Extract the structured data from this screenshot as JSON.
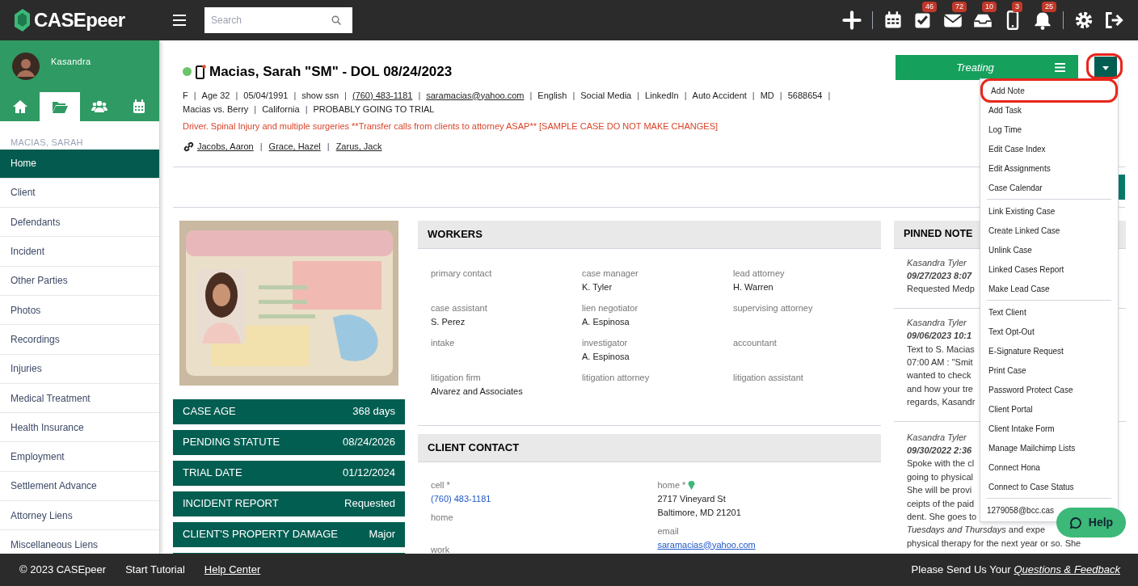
{
  "topbar": {
    "brand": "CASEpeer",
    "search": {
      "placeholder": "Search"
    },
    "icons": [
      {
        "kind": "plus"
      },
      {
        "kind": "divider"
      },
      {
        "kind": "calendar"
      },
      {
        "kind": "tasks",
        "badge": "46"
      },
      {
        "kind": "mail",
        "badge": "72"
      },
      {
        "kind": "inbox",
        "badge": "10"
      },
      {
        "kind": "phone",
        "badge": "3"
      },
      {
        "kind": "bell",
        "badge": "25"
      },
      {
        "kind": "divider"
      },
      {
        "kind": "gear"
      },
      {
        "kind": "logout"
      }
    ]
  },
  "sidebar": {
    "user": "Kasandra",
    "tabs": [
      {
        "kind": "home",
        "selected": false
      },
      {
        "kind": "folder",
        "selected": true
      },
      {
        "kind": "people",
        "selected": false
      },
      {
        "kind": "calendar",
        "selected": false
      }
    ],
    "case_label": "MACIAS, SARAH",
    "items": [
      {
        "label": "Home",
        "selected": true
      },
      {
        "label": "Client",
        "selected": false
      },
      {
        "label": "Defendants",
        "selected": false
      },
      {
        "label": "Incident",
        "selected": false
      },
      {
        "label": "Other Parties",
        "selected": false
      },
      {
        "label": "Photos",
        "selected": false
      },
      {
        "label": "Recordings",
        "selected": false
      },
      {
        "label": "Injuries",
        "selected": false
      },
      {
        "label": "Medical Treatment",
        "selected": false
      },
      {
        "label": "Health Insurance",
        "selected": false
      },
      {
        "label": "Employment",
        "selected": false
      },
      {
        "label": "Settlement Advance",
        "selected": false
      },
      {
        "label": "Attorney Liens",
        "selected": false
      },
      {
        "label": "Miscellaneous Liens",
        "selected": false
      }
    ]
  },
  "case": {
    "online": true,
    "title": "Macias, Sarah \"SM\" - DOL 08/24/2023",
    "info": [
      {
        "text": "F",
        "link": false
      },
      {
        "text": "Age 32",
        "link": false
      },
      {
        "text": "05/04/1991",
        "link": false
      },
      {
        "text": "show ssn",
        "link": false
      },
      {
        "text": "(760) 483-1181",
        "link": true
      },
      {
        "text": "saramacias@yahoo.com",
        "link": true
      },
      {
        "text": "English",
        "link": false
      },
      {
        "text": "Social Media",
        "link": false
      },
      {
        "text": "LinkedIn",
        "link": false
      },
      {
        "text": "Auto Accident",
        "link": false
      },
      {
        "text": "MD",
        "link": false
      },
      {
        "text": "5688654",
        "link": false
      },
      {
        "text": "Macias vs. Berry",
        "link": false
      },
      {
        "text": "California",
        "link": false
      },
      {
        "text": "PROBABLY GOING TO TRIAL",
        "link": false
      }
    ],
    "alert": "Driver. Spinal Injury and multiple surgeries **Transfer calls from clients to attorney ASAP** [SAMPLE CASE DO NOT MAKE CHANGES]",
    "linked": [
      "Jacobs, Aaron",
      "Grace, Hazel",
      "Zarus, Jack"
    ],
    "status": "Treating",
    "separator": "|",
    "toggle_highlighted": true
  },
  "stats": [
    {
      "label": "CASE AGE",
      "value": "368 days"
    },
    {
      "label": "PENDING STATUTE",
      "value": "08/24/2026"
    },
    {
      "label": "TRIAL DATE",
      "value": "01/12/2024"
    },
    {
      "label": "INCIDENT REPORT",
      "value": "Requested"
    },
    {
      "label": "CLIENT'S PROPERTY DAMAGE",
      "value": "Major"
    }
  ],
  "workers": {
    "title": "WORKERS",
    "fields": [
      {
        "label": "primary contact"
      },
      {
        "label": "case manager",
        "value": "K. Tyler"
      },
      {
        "label": "lead attorney",
        "value": "H. Warren"
      },
      {
        "label": "case assistant",
        "value": "S. Perez"
      },
      {
        "label": "lien negotiator",
        "value": "A. Espinosa"
      },
      {
        "label": "supervising attorney"
      },
      {
        "label": "intake"
      },
      {
        "label": "investigator",
        "value": "A. Espinosa"
      },
      {
        "label": "accountant"
      },
      {
        "label": "litigation firm",
        "value": "Alvarez and Associates"
      },
      {
        "label": "litigation attorney"
      },
      {
        "label": "litigation assistant"
      }
    ]
  },
  "client_contact": {
    "title": "CLIENT CONTACT",
    "left": [
      {
        "label": "cell *",
        "lines": [
          "(760) 483-1181"
        ],
        "link": true
      },
      {
        "label": "home"
      },
      {
        "label": "work"
      }
    ],
    "right": [
      {
        "label": "home *",
        "pin": true,
        "lines": [
          "2717 Vineyard St",
          "Baltimore, MD 21201"
        ]
      },
      {
        "label": "email",
        "lines": [
          "saramacias@yahoo.com"
        ],
        "link": true
      }
    ]
  },
  "pinned_notes": {
    "title": "PINNED NOTE",
    "notes": [
      {
        "author": "Kasandra Tyler",
        "date": "09/27/2023 8:07",
        "lines": [
          "Requested Medp"
        ]
      },
      {
        "author": "Kasandra Tyler",
        "date": "09/06/2023 10:1",
        "lines": [
          "Text to S. Macias",
          "07:00 AM : \"Smit",
          "wanted to check",
          "and how your tre",
          "regards, Kasandr"
        ]
      },
      {
        "author": "Kasandra Tyler",
        "date": "09/30/2022 2:36",
        "lines": [
          "Spoke with the cl",
          "going to physical",
          "She will be provi",
          "ceipts of the paid",
          "dent. She goes to",
          "*Tuesdays and Thursdays* and expe",
          "physical therapy for the next year or so. She"
        ]
      }
    ]
  },
  "menu": {
    "groups": [
      [
        {
          "label": "Add Note",
          "highlighted": true
        },
        {
          "label": "Add Task",
          "highlighted": false
        },
        {
          "label": "Log Time",
          "highlighted": false
        },
        {
          "label": "Edit Case Index",
          "highlighted": false
        },
        {
          "label": "Edit Assignments",
          "highlighted": false
        },
        {
          "label": "Case Calendar",
          "highlighted": false
        }
      ],
      [
        {
          "label": "Link Existing Case",
          "highlighted": false
        },
        {
          "label": "Create Linked Case",
          "highlighted": false
        },
        {
          "label": "Unlink Case",
          "highlighted": false
        },
        {
          "label": "Linked Cases Report",
          "highlighted": false
        },
        {
          "label": "Make Lead Case",
          "highlighted": false
        }
      ],
      [
        {
          "label": "Text Client",
          "highlighted": false
        },
        {
          "label": "Text Opt-Out",
          "highlighted": false
        },
        {
          "label": "E-Signature Request",
          "highlighted": false
        },
        {
          "label": "Print Case",
          "highlighted": false
        },
        {
          "label": "Password Protect Case",
          "highlighted": false
        },
        {
          "label": "Client Portal",
          "highlighted": false
        },
        {
          "label": "Client Intake Form",
          "highlighted": false
        },
        {
          "label": "Manage Mailchimp Lists",
          "highlighted": false
        },
        {
          "label": "Connect Hona",
          "highlighted": false
        },
        {
          "label": "Connect to Case Status",
          "highlighted": false
        }
      ],
      [
        {
          "label": "1279058@bcc.cas",
          "highlighted": false
        }
      ]
    ]
  },
  "help": "Help",
  "footer": {
    "copyright": "© 2023 CASEpeer",
    "links": [
      "Start Tutorial",
      "Help Center"
    ],
    "feedback_prefix": "Please Send Us Your",
    "feedback_link": "Questions & Feedback"
  }
}
